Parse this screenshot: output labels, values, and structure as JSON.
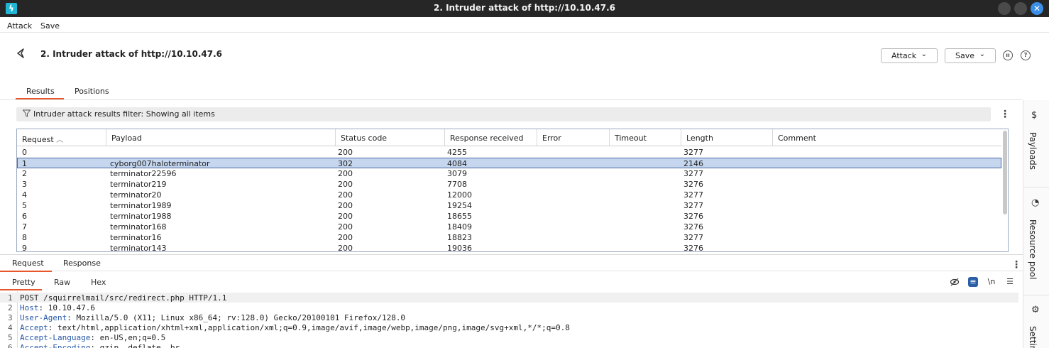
{
  "window": {
    "title": "2. Intruder attack of http://10.10.47.6"
  },
  "menu": {
    "items": [
      "Attack",
      "Save"
    ]
  },
  "header": {
    "title": "2. Intruder attack of http://10.10.47.6",
    "attack_label": "Attack",
    "save_label": "Save"
  },
  "tabs": [
    "Results",
    "Positions"
  ],
  "filter": {
    "text": "Intruder attack results filter: Showing all items"
  },
  "table": {
    "columns": [
      "Request",
      "Payload",
      "Status code",
      "Response received",
      "Error",
      "Timeout",
      "Length",
      "Comment"
    ],
    "rows": [
      [
        "0",
        "",
        "200",
        "4255",
        "",
        "",
        "3277",
        ""
      ],
      [
        "1",
        "cyborg007haloterminator",
        "302",
        "4084",
        "",
        "",
        "2146",
        ""
      ],
      [
        "2",
        "terminator22596",
        "200",
        "3079",
        "",
        "",
        "3277",
        ""
      ],
      [
        "3",
        "terminator219",
        "200",
        "7708",
        "",
        "",
        "3276",
        ""
      ],
      [
        "4",
        "terminator20",
        "200",
        "12000",
        "",
        "",
        "3277",
        ""
      ],
      [
        "5",
        "terminator1989",
        "200",
        "19254",
        "",
        "",
        "3277",
        ""
      ],
      [
        "6",
        "terminator1988",
        "200",
        "18655",
        "",
        "",
        "3276",
        ""
      ],
      [
        "7",
        "terminator168",
        "200",
        "18409",
        "",
        "",
        "3276",
        ""
      ],
      [
        "8",
        "terminator16",
        "200",
        "18823",
        "",
        "",
        "3277",
        ""
      ],
      [
        "9",
        "terminator143",
        "200",
        "19036",
        "",
        "",
        "3276",
        ""
      ]
    ],
    "selected_row": 1
  },
  "side_panel": {
    "payloads": "Payloads",
    "resource_pool": "Resource pool",
    "settings": "Settings"
  },
  "bottom": {
    "tabs": [
      "Request",
      "Response"
    ],
    "view_tabs": [
      "Pretty",
      "Raw",
      "Hex"
    ],
    "newline_label": "\\n"
  },
  "request_lines": [
    {
      "num": "1",
      "name": "",
      "value": "POST /squirrelmail/src/redirect.php HTTP/1.1"
    },
    {
      "num": "2",
      "name": "Host",
      "value": ": 10.10.47.6"
    },
    {
      "num": "3",
      "name": "User-Agent",
      "value": ": Mozilla/5.0 (X11; Linux x86_64; rv:128.0) Gecko/20100101 Firefox/128.0"
    },
    {
      "num": "4",
      "name": "Accept",
      "value": ": text/html,application/xhtml+xml,application/xml;q=0.9,image/avif,image/webp,image/png,image/svg+xml,*/*;q=0.8"
    },
    {
      "num": "5",
      "name": "Accept-Language",
      "value": ": en-US,en;q=0.5"
    },
    {
      "num": "6",
      "name": "Accept-Encoding",
      "value": ": gzip, deflate, br"
    }
  ],
  "colors": {
    "accent": "#e8572b",
    "selection": "#c5d6ee",
    "titlebar": "#262626"
  }
}
